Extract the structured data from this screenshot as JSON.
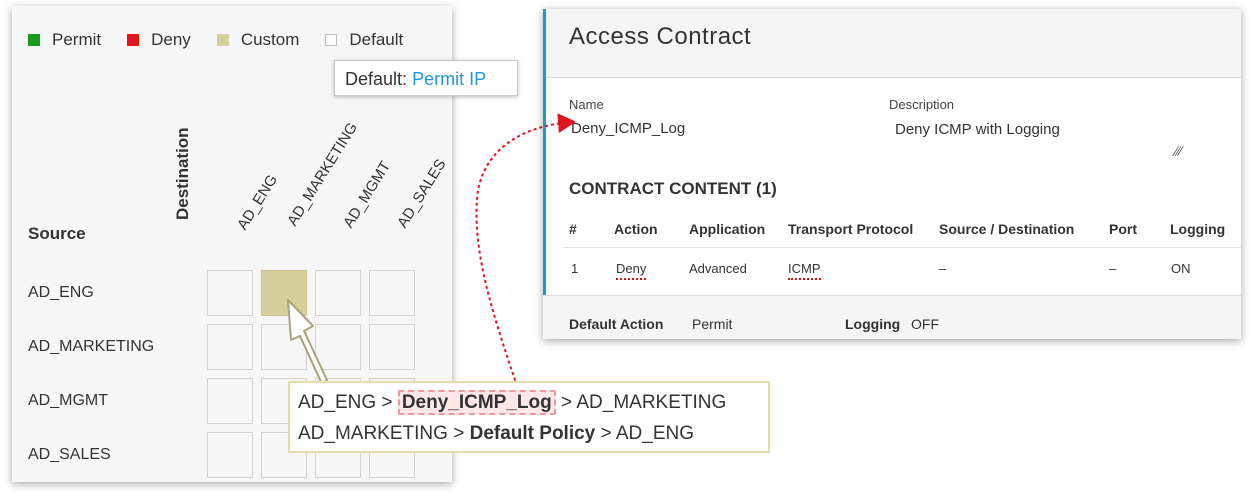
{
  "legend": {
    "items": [
      {
        "label": "Permit",
        "color": "#1a9a1a"
      },
      {
        "label": "Deny",
        "color": "#e0141c"
      },
      {
        "label": "Custom",
        "color": "#d4cf9b"
      },
      {
        "label": "Default",
        "color": "#ffffff"
      }
    ]
  },
  "default_badge": {
    "prefix": "Default:",
    "value": "Permit IP"
  },
  "matrix": {
    "destination_label": "Destination",
    "source_label": "Source",
    "columns": [
      "AD_ENG",
      "AD_MARKETING",
      "AD_MGMT",
      "AD_SALES"
    ],
    "rows": [
      "AD_ENG",
      "AD_MARKETING",
      "AD_MGMT",
      "AD_SALES"
    ]
  },
  "contract": {
    "title": "Access Contract",
    "name_label": "Name",
    "name_value": "Deny_ICMP_Log",
    "description_label": "Description",
    "description_value": "Deny ICMP with Logging",
    "section_title": "CONTRACT CONTENT (1)",
    "table": {
      "headers": [
        "#",
        "Action",
        "Application",
        "Transport Protocol",
        "Source / Destination",
        "Port",
        "Logging"
      ],
      "rows": [
        [
          "1",
          "Deny",
          "Advanced",
          "ICMP",
          "–",
          "–",
          "ON"
        ]
      ]
    },
    "footer": {
      "default_action_label": "Default Action",
      "default_action_value": "Permit",
      "logging_label": "Logging",
      "logging_value": "OFF"
    }
  },
  "callout": {
    "line1": {
      "src": "AD_ENG",
      "sep": ">",
      "policy": "Deny_ICMP_Log",
      "dst": "AD_MARKETING"
    },
    "line2": {
      "src": "AD_MARKETING",
      "sep": ">",
      "policy": "Default Policy",
      "dst": "AD_ENG"
    }
  }
}
